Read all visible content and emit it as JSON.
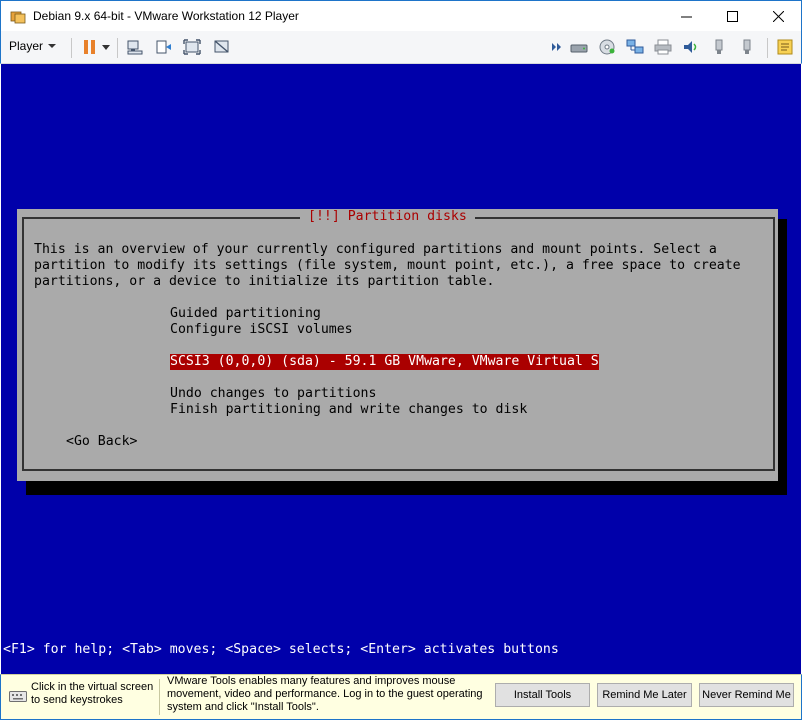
{
  "window": {
    "title": "Debian 9.x 64-bit - VMware Workstation 12 Player",
    "minimize": "—",
    "maximize": "☐",
    "close": "✕"
  },
  "toolbar": {
    "player_label": "Player"
  },
  "installer": {
    "dialog_title": "[!!] Partition disks",
    "intro_line1": "This is an overview of your currently configured partitions and mount points. Select a",
    "intro_line2": "partition to modify its settings (file system, mount point, etc.), a free space to create",
    "intro_line3": "partitions, or a device to initialize its partition table.",
    "options": [
      "Guided partitioning",
      "Configure iSCSI volumes",
      "SCSI3 (0,0,0) (sda) - 59.1 GB VMware, VMware Virtual S",
      "Undo changes to partitions",
      "Finish partitioning and write changes to disk"
    ],
    "go_back": "<Go Back>",
    "help_line": "<F1> for help; <Tab> moves; <Space> selects; <Enter> activates buttons"
  },
  "notification": {
    "hint_line1": "Click in the virtual screen",
    "hint_line2": "to send keystrokes",
    "message_line1": "VMware Tools enables many features and improves mouse",
    "message_line2": "movement, video and performance. Log in to the guest operating",
    "message_line3": "system and click \"Install Tools\".",
    "install_label": "Install Tools",
    "remind_label": "Remind Me Later",
    "never_label": "Never Remind Me"
  },
  "colors": {
    "guest_background": "#0000aa",
    "dialog_background": "#aaaaaa",
    "selection": "#aa0000",
    "notification_background": "#ffffe1"
  },
  "icons": {
    "app": "vmware-app-icon",
    "pause": "pause-icon",
    "send_ctrl_alt_del": "ctrl-alt-del-icon",
    "fit_guest": "fit-guest-icon",
    "full_screen": "full-screen-icon",
    "unity": "unity-icon",
    "devices": [
      "chevron-double-right-icon",
      "hard-disk-icon",
      "cd-icon",
      "network-icon",
      "printer-icon",
      "sound-icon",
      "usb-icon",
      "usb-icon-2",
      "messages-icon"
    ]
  }
}
